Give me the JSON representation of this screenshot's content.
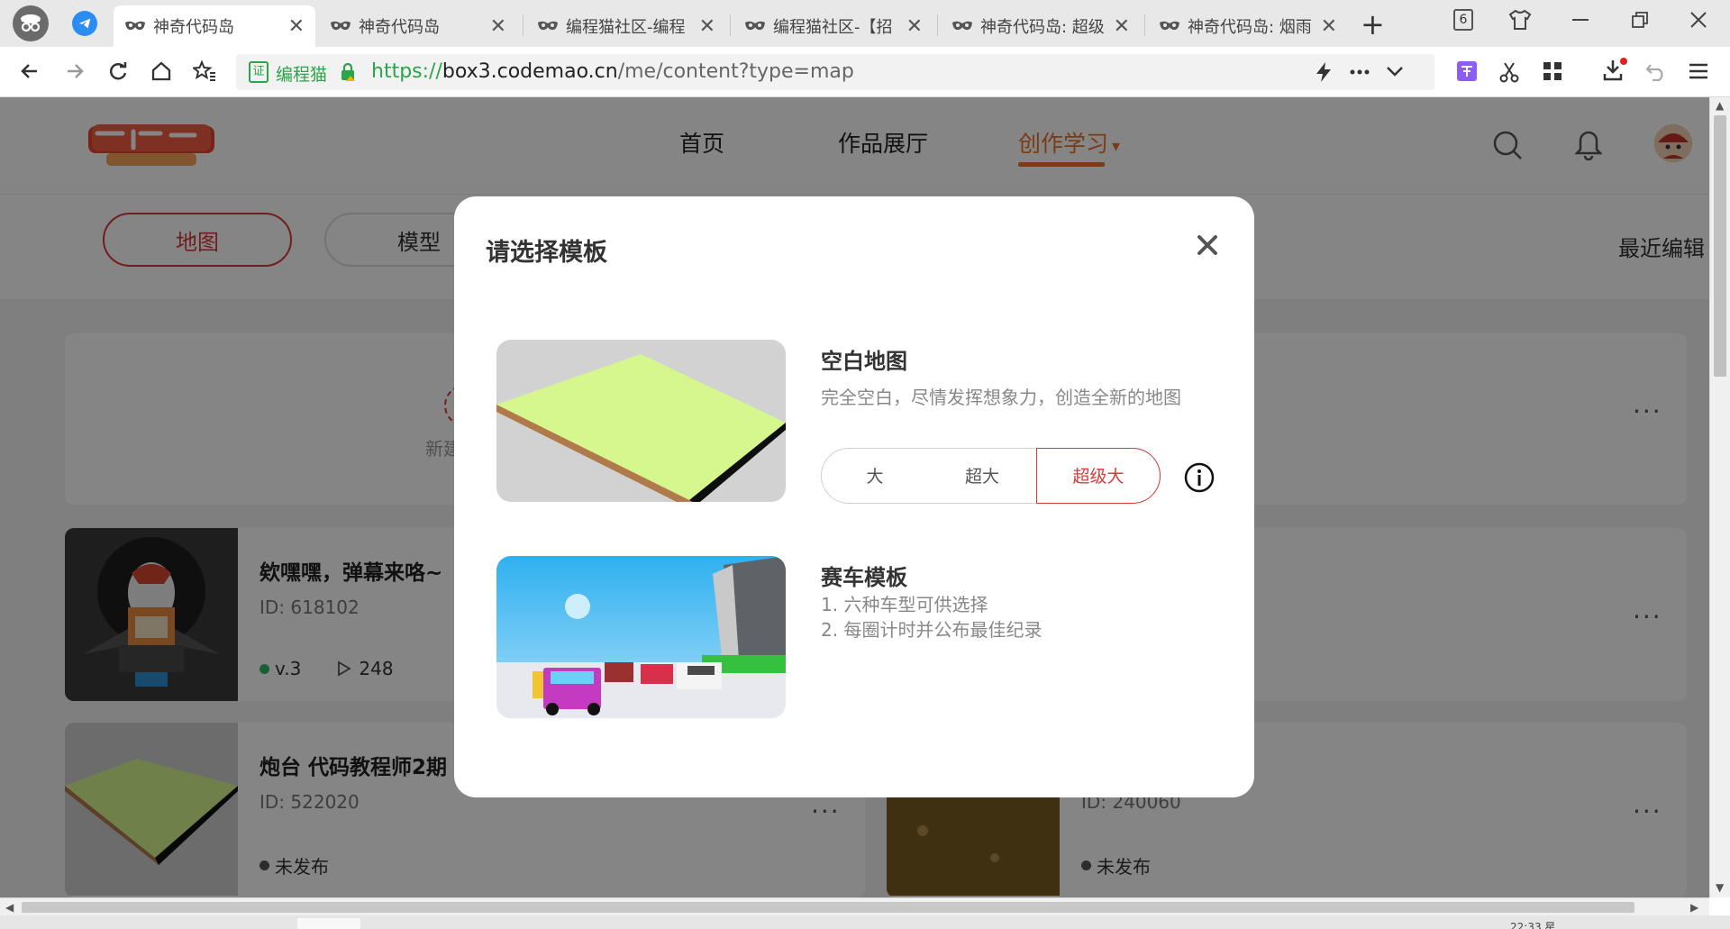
{
  "browser": {
    "tabs": [
      {
        "label": "神奇代码岛",
        "active": true
      },
      {
        "label": "神奇代码岛",
        "active": false
      },
      {
        "label": "编程猫社区-编程",
        "active": false
      },
      {
        "label": "编程猫社区-【招",
        "active": false
      },
      {
        "label": "神奇代码岛: 超级",
        "active": false
      },
      {
        "label": "神奇代码岛: 烟雨",
        "active": false
      }
    ],
    "tab_close_glyph": "✕",
    "new_tab_glyph": "+",
    "tab_count": "6",
    "cert_glyph": "证",
    "cert_label": "编程猫",
    "url": {
      "protocol": "https://",
      "host": "box3.codemao.cn",
      "path": "/me/content?type=map"
    },
    "bottom_status_text": "22:33 星..."
  },
  "site": {
    "nav": [
      {
        "label": "首页",
        "active": false
      },
      {
        "label": "作品展厅",
        "active": false
      },
      {
        "label": "创作学习",
        "active": true
      }
    ],
    "nav_dropdown_glyph": "▾",
    "accent_color": "#e8732a",
    "brand_red": "#d93a3a"
  },
  "filters": {
    "items": [
      {
        "label": "地图",
        "active": true
      },
      {
        "label": "模型",
        "active": false
      }
    ],
    "recent_edit": "最近编辑"
  },
  "works": {
    "new_card_text": "新建",
    "cards": [
      {
        "title": "欸嘿嘿，弹幕来咯~",
        "id": "ID: 618102",
        "version": "v.3",
        "plays": "248",
        "status_color": "#2fb86a"
      },
      {
        "title": "炮台 代码教程师2期",
        "id": "ID: 522020",
        "status": "未发布",
        "status_color": "#555555"
      },
      {
        "id": "ID: 240060",
        "status": "未发布",
        "status_color": "#555555"
      }
    ],
    "more_glyph": "···"
  },
  "modal": {
    "title": "请选择模板",
    "templates": [
      {
        "name": "空白地图",
        "description": "完全空白，尽情发挥想象力，创造全新的地图",
        "sizes": [
          "大",
          "超大",
          "超级大"
        ],
        "selected_size": "超级大",
        "info_icon": "info-icon"
      },
      {
        "name": "赛车模板",
        "lines": [
          "1. 六种车型可供选择",
          "2. 每圈计时并公布最佳纪录"
        ]
      }
    ]
  }
}
